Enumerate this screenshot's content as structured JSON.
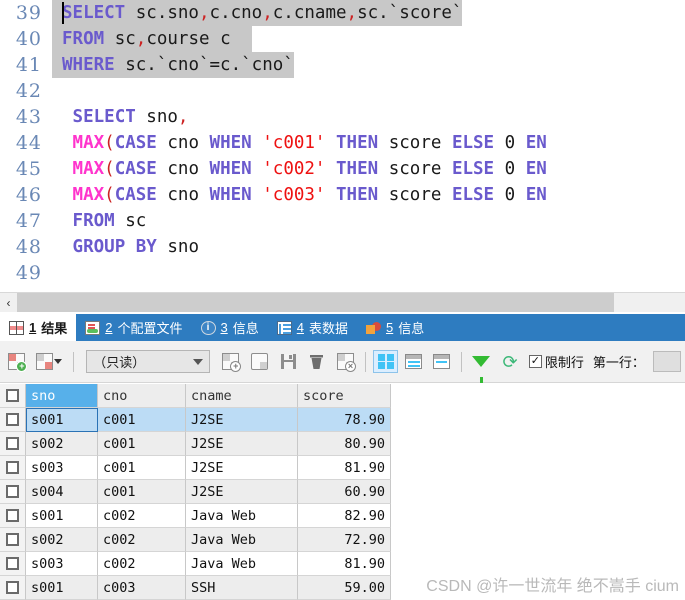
{
  "editor": {
    "lines": [
      {
        "num": "39",
        "selected": true,
        "caret": true,
        "tokens": [
          {
            "t": "SELECT",
            "c": "kw"
          },
          {
            "t": " sc.sno",
            "c": ""
          },
          {
            "t": ",",
            "c": "pun"
          },
          {
            "t": "c.cno",
            "c": ""
          },
          {
            "t": ",",
            "c": "pun"
          },
          {
            "t": "c.cname",
            "c": ""
          },
          {
            "t": ",",
            "c": "pun"
          },
          {
            "t": "sc.`score`",
            "c": ""
          }
        ]
      },
      {
        "num": "40",
        "selected": true,
        "caret": false,
        "tokens": [
          {
            "t": "FROM",
            "c": "kw"
          },
          {
            "t": " sc",
            "c": ""
          },
          {
            "t": ",",
            "c": "pun"
          },
          {
            "t": "course c  ",
            "c": ""
          }
        ]
      },
      {
        "num": "41",
        "selected": true,
        "caret": false,
        "tokens": [
          {
            "t": "WHERE",
            "c": "kw"
          },
          {
            "t": " sc.`cno`=c.`cno`",
            "c": ""
          }
        ]
      },
      {
        "num": "42",
        "selected": false,
        "caret": false,
        "tokens": []
      },
      {
        "num": "43",
        "selected": false,
        "caret": false,
        "tokens": [
          {
            "t": " ",
            "c": ""
          },
          {
            "t": "SELECT",
            "c": "kw"
          },
          {
            "t": " sno",
            "c": ""
          },
          {
            "t": ",",
            "c": "pun"
          }
        ]
      },
      {
        "num": "44",
        "selected": false,
        "caret": false,
        "tokens": [
          {
            "t": " ",
            "c": ""
          },
          {
            "t": "MAX",
            "c": "fn"
          },
          {
            "t": "(",
            "c": "pun"
          },
          {
            "t": "CASE",
            "c": "kw"
          },
          {
            "t": " cno ",
            "c": ""
          },
          {
            "t": "WHEN",
            "c": "kw"
          },
          {
            "t": " ",
            "c": ""
          },
          {
            "t": "'c001'",
            "c": "str"
          },
          {
            "t": " ",
            "c": ""
          },
          {
            "t": "THEN",
            "c": "kw"
          },
          {
            "t": " score ",
            "c": ""
          },
          {
            "t": "ELSE",
            "c": "kw"
          },
          {
            "t": " 0 ",
            "c": ""
          },
          {
            "t": "EN",
            "c": "kw"
          }
        ]
      },
      {
        "num": "45",
        "selected": false,
        "caret": false,
        "tokens": [
          {
            "t": " ",
            "c": ""
          },
          {
            "t": "MAX",
            "c": "fn"
          },
          {
            "t": "(",
            "c": "pun"
          },
          {
            "t": "CASE",
            "c": "kw"
          },
          {
            "t": " cno ",
            "c": ""
          },
          {
            "t": "WHEN",
            "c": "kw"
          },
          {
            "t": " ",
            "c": ""
          },
          {
            "t": "'c002'",
            "c": "str"
          },
          {
            "t": " ",
            "c": ""
          },
          {
            "t": "THEN",
            "c": "kw"
          },
          {
            "t": " score ",
            "c": ""
          },
          {
            "t": "ELSE",
            "c": "kw"
          },
          {
            "t": " 0 ",
            "c": ""
          },
          {
            "t": "EN",
            "c": "kw"
          }
        ]
      },
      {
        "num": "46",
        "selected": false,
        "caret": false,
        "tokens": [
          {
            "t": " ",
            "c": ""
          },
          {
            "t": "MAX",
            "c": "fn"
          },
          {
            "t": "(",
            "c": "pun"
          },
          {
            "t": "CASE",
            "c": "kw"
          },
          {
            "t": " cno ",
            "c": ""
          },
          {
            "t": "WHEN",
            "c": "kw"
          },
          {
            "t": " ",
            "c": ""
          },
          {
            "t": "'c003'",
            "c": "str"
          },
          {
            "t": " ",
            "c": ""
          },
          {
            "t": "THEN",
            "c": "kw"
          },
          {
            "t": " score ",
            "c": ""
          },
          {
            "t": "ELSE",
            "c": "kw"
          },
          {
            "t": " 0 ",
            "c": ""
          },
          {
            "t": "EN",
            "c": "kw"
          }
        ]
      },
      {
        "num": "47",
        "selected": false,
        "caret": false,
        "tokens": [
          {
            "t": " ",
            "c": ""
          },
          {
            "t": "FROM",
            "c": "kw"
          },
          {
            "t": " sc",
            "c": ""
          }
        ]
      },
      {
        "num": "48",
        "selected": false,
        "caret": false,
        "tokens": [
          {
            "t": " ",
            "c": ""
          },
          {
            "t": "GROUP BY",
            "c": "kw"
          },
          {
            "t": " sno",
            "c": ""
          }
        ]
      },
      {
        "num": "49",
        "selected": false,
        "caret": false,
        "tokens": []
      }
    ]
  },
  "scrollbar": {
    "left_arrow": "‹"
  },
  "tabs": [
    {
      "num": "1",
      "label": "结果",
      "icon": "result-grid-icon",
      "active": true
    },
    {
      "num": "2",
      "label": "个配置文件",
      "icon": "profile-icon",
      "active": false
    },
    {
      "num": "3",
      "label": "信息",
      "icon": "info-icon",
      "active": false
    },
    {
      "num": "4",
      "label": "表数据",
      "icon": "table-data-icon",
      "active": false
    },
    {
      "num": "5",
      "label": "信息",
      "icon": "shapes-icon",
      "active": false
    }
  ],
  "toolbar": {
    "add_record_icon": "add-record-icon",
    "grid_options_icon": "grid-options-icon",
    "mode_value": "（只读）",
    "insert_row_icon": "insert-row-icon",
    "edit_row_icon": "edit-row-icon",
    "save_icon": "save-icon",
    "delete_icon": "delete-trash-icon",
    "cancel_icon": "cancel-record-icon",
    "view_grid_icon": "view-grid-icon",
    "view_form_icon": "view-form-icon",
    "view_text_icon": "view-text-icon",
    "filter_icon": "filter-funnel-icon",
    "refresh_icon": "refresh-icon",
    "limit_checkbox_mark": "✓",
    "limit_label": "限制行",
    "first_row_label": "第一行：",
    "first_row_value": ""
  },
  "grid": {
    "columns": [
      "sno",
      "cno",
      "cname",
      "score"
    ],
    "active_column": "sno",
    "widths": [
      72,
      88,
      112,
      93
    ],
    "rows": [
      {
        "cells": [
          "s001",
          "c001",
          "J2SE",
          "78.90"
        ],
        "selected": true
      },
      {
        "cells": [
          "s002",
          "c001",
          "J2SE",
          "80.90"
        ],
        "selected": false
      },
      {
        "cells": [
          "s003",
          "c001",
          "J2SE",
          "81.90"
        ],
        "selected": false
      },
      {
        "cells": [
          "s004",
          "c001",
          "J2SE",
          "60.90"
        ],
        "selected": false
      },
      {
        "cells": [
          "s001",
          "c002",
          "Java Web",
          "82.90"
        ],
        "selected": false
      },
      {
        "cells": [
          "s002",
          "c002",
          "Java Web",
          "72.90"
        ],
        "selected": false
      },
      {
        "cells": [
          "s003",
          "c002",
          "Java Web",
          "81.90"
        ],
        "selected": false
      },
      {
        "cells": [
          "s001",
          "c003",
          "SSH",
          "59.00"
        ],
        "selected": false
      }
    ]
  },
  "watermark": {
    "text": "CSDN @许一世流年 绝不嵩手 cium"
  }
}
